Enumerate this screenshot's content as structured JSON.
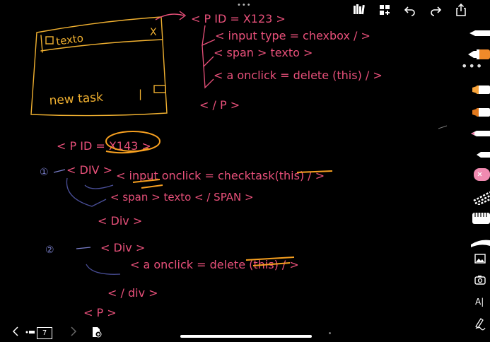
{
  "app": {
    "title_dots": "•••",
    "more_menu": "•••"
  },
  "toolbar": {
    "items": [
      {
        "name": "library-icon",
        "label": ""
      },
      {
        "name": "add-page-icon",
        "label": ""
      },
      {
        "name": "undo-icon",
        "label": ""
      },
      {
        "name": "redo-icon",
        "label": ""
      },
      {
        "name": "share-icon",
        "label": ""
      }
    ]
  },
  "side_tools": [
    {
      "name": "pen-white",
      "color": "#ffffff"
    },
    {
      "name": "pen-orange",
      "color": "#f08a2a"
    },
    {
      "name": "marker-orange",
      "color": "#f7a33a"
    },
    {
      "name": "marker-dark-orange",
      "color": "#e0781c"
    },
    {
      "name": "pen-pink",
      "color": "#f06ea0"
    },
    {
      "name": "pen-small-white",
      "color": "#ffffff"
    },
    {
      "name": "eraser-pink",
      "color": "#f08ab0"
    },
    {
      "name": "lasso",
      "color": "#ffffff"
    },
    {
      "name": "ruler",
      "color": "#ffffff"
    },
    {
      "name": "shape-tool",
      "color": "#ffffff"
    },
    {
      "name": "image-tool",
      "color": "#ffffff"
    },
    {
      "name": "camera-tool",
      "color": "#ffffff"
    },
    {
      "name": "text-tool",
      "label": "A|"
    },
    {
      "name": "handwriting-tool",
      "color": "#ffffff"
    }
  ],
  "page": {
    "current": "7"
  },
  "notes": {
    "sketch_box_label": "texto",
    "sketch_close": "X",
    "sketch_new_task": "new task",
    "line_p_open": "< P  ID = X123  >",
    "line_input": "< input  type = chexbox / >",
    "line_span": "< span > texto >",
    "line_a": "< a  onclick = delete (this) / >",
    "line_p_close": "< / P >",
    "p2_open": "< P  ID = X143  >",
    "div1_open": "< DIV >",
    "input_onclick": "< input  onclick = checktask(this) / >",
    "span_texto": "< span >  texto < / SPAN >",
    "div1_close": "< Div >",
    "div2_open": "< Div >",
    "a_onclick": "< a  onclick = delete (this) / >",
    "div2_close": "< / div >",
    "p_close": "< P >",
    "marker1": "①",
    "marker2": "②"
  },
  "colors": {
    "pink": "#e8507a",
    "orange": "#f7a020",
    "yellow": "#f0c040",
    "blue": "#7a7fcc",
    "white": "#ffffff"
  }
}
